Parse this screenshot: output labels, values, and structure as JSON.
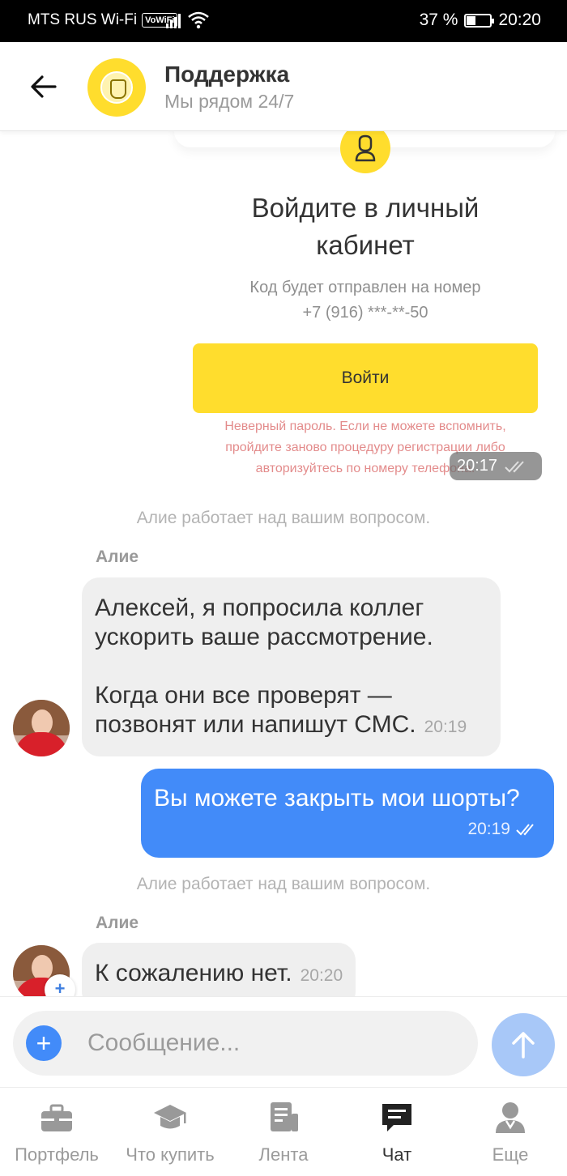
{
  "status_bar": {
    "carrier": "MTS RUS Wi-Fi",
    "vowifi_badge": "VoWiFi",
    "battery_percent": "37 %",
    "battery_level": 0.37,
    "time": "20:20"
  },
  "header": {
    "title": "Поддержка",
    "subtitle": "Мы рядом 24/7"
  },
  "login_card": {
    "title_line1": "Войдите в личный",
    "title_line2": "кабинет",
    "note_line1": "Код будет отправлен на номер",
    "note_line2": "+7 (916) ***-**-50",
    "button_label": "Войти",
    "error_line1": "Неверный пароль. Если не можете вспомнить,",
    "error_line2": "пройдите заново процедуру регистрации либо",
    "error_line3": "авторизуйтесь по номеру телефона.",
    "time": "20:17"
  },
  "messages": {
    "system_note_1": "Алие работает над вашим вопросом.",
    "sender_1": "Алие",
    "incoming_1_line1": "Алексей, я попросила  коллег",
    "incoming_1_line2": "ускорить ваше рассмотрение.",
    "incoming_1_line3": "Когда они все проверят —",
    "incoming_1_line4": "позвонят или напишут СМС.",
    "incoming_1_time": "20:19",
    "outgoing_1_text": "Вы можете закрыть мои шорты?",
    "outgoing_1_time": "20:19",
    "system_note_2": "Алие работает над вашим вопросом.",
    "sender_2": "Алие",
    "incoming_2_text": "К сожалению нет.",
    "incoming_2_time": "20:20",
    "avatar_badge": "+"
  },
  "input": {
    "placeholder": "Сообщение...",
    "attach_symbol": "+"
  },
  "nav": {
    "items": [
      {
        "label": "Портфель",
        "icon": "briefcase-icon"
      },
      {
        "label": "Что купить",
        "icon": "graduation-cap-icon"
      },
      {
        "label": "Лента",
        "icon": "news-feed-icon"
      },
      {
        "label": "Чат",
        "icon": "chat-icon"
      },
      {
        "label": "Еще",
        "icon": "profile-icon"
      }
    ],
    "active_index": 3
  },
  "colors": {
    "accent_yellow": "#ffdd2d",
    "outgoing_blue": "#428bf9",
    "error_text": "#e38b8b"
  }
}
